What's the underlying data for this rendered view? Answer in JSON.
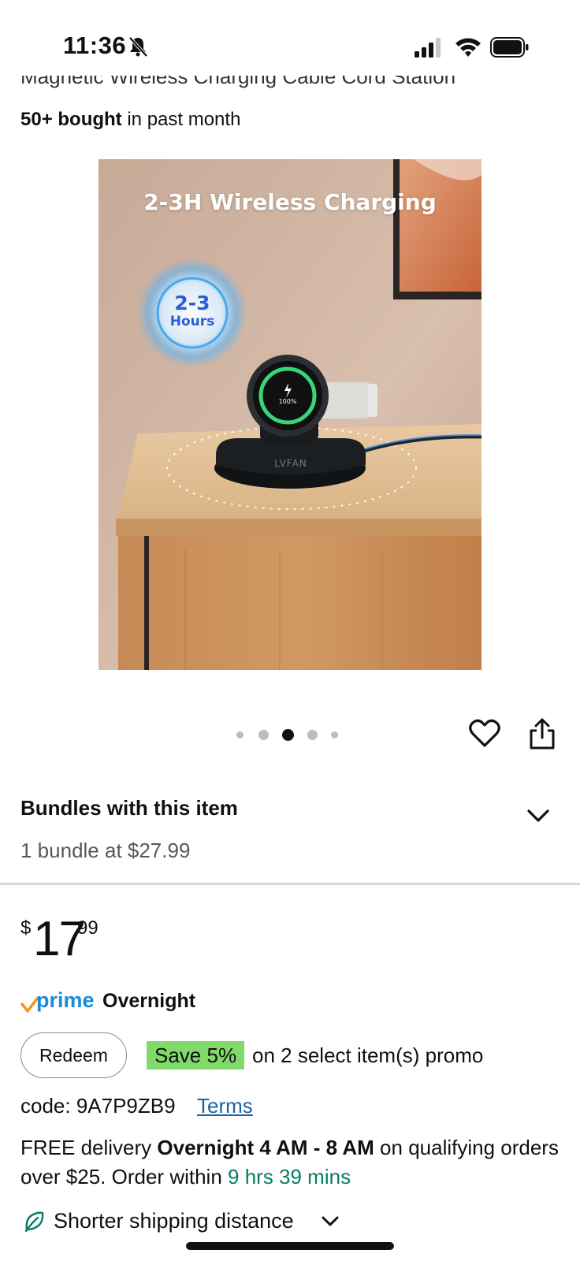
{
  "status_bar": {
    "time": "11:36",
    "icons": [
      "bell-slash-icon",
      "signal-icon",
      "wifi-icon",
      "battery-icon"
    ]
  },
  "product": {
    "title_partial": "Magnetic Wireless Charging Cable Cord Station",
    "bought_bold": "50+ bought",
    "bought_rest": " in past month",
    "image": {
      "caption": "2-3H Wireless Charging",
      "badge_number": "2-3",
      "badge_unit": "Hours",
      "watch_percent": "100%",
      "dock_brand": "LVFAN"
    },
    "carousel": {
      "count": 5,
      "active_index": 2
    }
  },
  "bundles": {
    "title": "Bundles with this item",
    "subtitle": "1 bundle at $27.99"
  },
  "price": {
    "currency": "$",
    "whole": "17",
    "fraction": "99"
  },
  "prime": {
    "word": "prime",
    "label": "Overnight"
  },
  "promo": {
    "redeem_label": "Redeem",
    "save_badge": "Save 5%",
    "text": "on 2 select item(s) promo",
    "code": "code: 9A7P9ZB9",
    "terms_label": "Terms"
  },
  "delivery": {
    "prefix": "FREE delivery ",
    "bold": "Overnight 4 AM - 8 AM",
    "middle": " on qualifying orders over $25. Order within ",
    "countdown": "9 hrs 39 mins"
  },
  "shipping": {
    "label": "Shorter shipping distance"
  },
  "colors": {
    "prime_blue": "#1a8cd8",
    "prime_check_orange": "#f7941d",
    "save_green": "#7fda69",
    "countdown_green": "#067d62",
    "link_blue": "#2162a1"
  }
}
